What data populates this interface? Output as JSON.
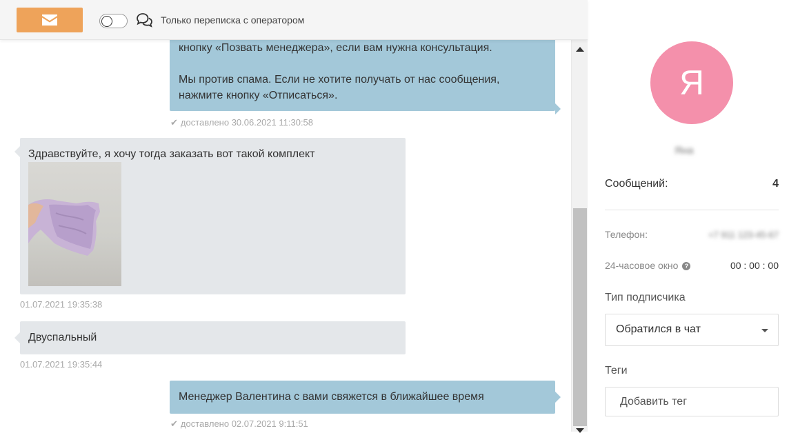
{
  "toolbar": {
    "mail_icon": "envelope-icon",
    "toggle_label": "Только переписка с оператором",
    "toggle_on": false,
    "chat_icon": "chat-bubbles-icon",
    "accent": "#eea35a"
  },
  "messages": [
    {
      "direction": "out",
      "lines": [
        "кнопку «Позвать менеджера», если вам нужна консультация.",
        "",
        "Мы против спама. Если не хотите получать от нас сообщения,",
        "нажмите кнопку «Отписаться»."
      ],
      "status": "доставлено 30.06.2021 11:30:58"
    },
    {
      "direction": "in",
      "text": "Здравствуйте, я хочу тогда заказать вот такой комплект",
      "has_image": true,
      "time": "01.07.2021 19:35:38"
    },
    {
      "direction": "in",
      "text": "Двуспальный",
      "time": "01.07.2021 19:35:44"
    },
    {
      "direction": "out",
      "text": "Менеджер Валентина с вами свяжется в ближайшее время",
      "status": "доставлено 02.07.2021 9:11:51"
    }
  ],
  "colors": {
    "outgoing_bubble": "#a3c8d9",
    "incoming_bubble": "#e4e7ea",
    "avatar": "#f490ab"
  },
  "profile": {
    "avatar_letter": "Я",
    "name": "Яна",
    "messages_label": "Сообщений:",
    "messages_count": "4",
    "phone_label": "Телефон:",
    "phone_value": "+7 911 123-45-67",
    "window_label": "24-часовое окно",
    "window_timer": "00 : 00 : 00",
    "subscriber_type_label": "Тип подписчика",
    "subscriber_type_value": "Обратился в чат",
    "tags_label": "Теги",
    "tags_placeholder": "Добавить тег"
  }
}
